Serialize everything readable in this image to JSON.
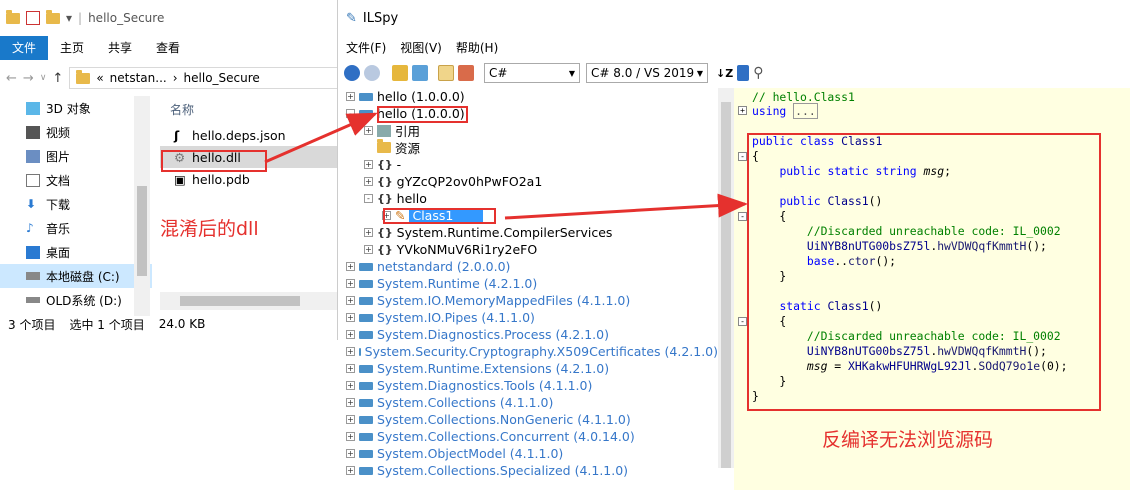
{
  "explorer": {
    "title": "hello_Secure",
    "ribbon": [
      "文件",
      "主页",
      "共享",
      "查看"
    ],
    "address": {
      "prefix": "«",
      "part1": "netstan...",
      "sep": "›",
      "part2": "hello_Secure"
    },
    "nav": [
      {
        "label": "3D 对象",
        "icon": "cube-icon"
      },
      {
        "label": "视频",
        "icon": "video-icon"
      },
      {
        "label": "图片",
        "icon": "picture-icon"
      },
      {
        "label": "文档",
        "icon": "document-icon"
      },
      {
        "label": "下载",
        "icon": "download-icon"
      },
      {
        "label": "音乐",
        "icon": "music-icon"
      },
      {
        "label": "桌面",
        "icon": "desktop-icon"
      },
      {
        "label": "本地磁盘 (C:)",
        "icon": "drive-icon"
      },
      {
        "label": "OLD系统 (D:)",
        "icon": "drive-icon"
      }
    ],
    "column_header": "名称",
    "files": [
      "hello.deps.json",
      "hello.dll",
      "hello.pdb"
    ],
    "status": {
      "count": "3 个项目",
      "selected": "选中 1 个项目",
      "size": "24.0 KB"
    }
  },
  "ilspy": {
    "title": "ILSpy",
    "menu": [
      "文件(F)",
      "视图(V)",
      "帮助(H)"
    ],
    "language": "C#",
    "version": "C# 8.0 / VS 2019",
    "tree": [
      {
        "label": "hello (1.0.0.0)",
        "exp": "+",
        "type": "asm",
        "indent": 0
      },
      {
        "label": "hello (1.0.0.0)",
        "exp": "-",
        "type": "asm",
        "indent": 0
      },
      {
        "label": "引用",
        "exp": "+",
        "type": "ref",
        "indent": 1
      },
      {
        "label": "资源",
        "exp": "",
        "type": "res",
        "indent": 1
      },
      {
        "label": "-",
        "exp": "+",
        "type": "ns",
        "indent": 1
      },
      {
        "label": "gYZcQP2ov0hPwFO2a1",
        "exp": "+",
        "type": "ns",
        "indent": 1
      },
      {
        "label": "hello",
        "exp": "-",
        "type": "ns",
        "indent": 1
      },
      {
        "label": "Class1",
        "exp": "+",
        "type": "class",
        "indent": 2
      },
      {
        "label": "System.Runtime.CompilerServices",
        "exp": "+",
        "type": "ns",
        "indent": 1
      },
      {
        "label": "YVkoNMuV6Ri1ry2eFO",
        "exp": "+",
        "type": "ns",
        "indent": 1
      },
      {
        "label": "netstandard (2.0.0.0)",
        "exp": "+",
        "type": "asm-blue",
        "indent": 0
      },
      {
        "label": "System.Runtime (4.2.1.0)",
        "exp": "+",
        "type": "asm-blue",
        "indent": 0
      },
      {
        "label": "System.IO.MemoryMappedFiles (4.1.1.0)",
        "exp": "+",
        "type": "asm-blue",
        "indent": 0
      },
      {
        "label": "System.IO.Pipes (4.1.1.0)",
        "exp": "+",
        "type": "asm-blue",
        "indent": 0
      },
      {
        "label": "System.Diagnostics.Process (4.2.1.0)",
        "exp": "+",
        "type": "asm-blue",
        "indent": 0
      },
      {
        "label": "System.Security.Cryptography.X509Certificates (4.2.1.0)",
        "exp": "+",
        "type": "asm-blue",
        "indent": 0
      },
      {
        "label": "System.Runtime.Extensions (4.2.1.0)",
        "exp": "+",
        "type": "asm-blue",
        "indent": 0
      },
      {
        "label": "System.Diagnostics.Tools (4.1.1.0)",
        "exp": "+",
        "type": "asm-blue",
        "indent": 0
      },
      {
        "label": "System.Collections (4.1.1.0)",
        "exp": "+",
        "type": "asm-blue",
        "indent": 0
      },
      {
        "label": "System.Collections.NonGeneric (4.1.1.0)",
        "exp": "+",
        "type": "asm-blue",
        "indent": 0
      },
      {
        "label": "System.Collections.Concurrent (4.0.14.0)",
        "exp": "+",
        "type": "asm-blue",
        "indent": 0
      },
      {
        "label": "System.ObjectModel (4.1.1.0)",
        "exp": "+",
        "type": "asm-blue",
        "indent": 0
      },
      {
        "label": "System.Collections.Specialized (4.1.1.0)",
        "exp": "+",
        "type": "asm-blue",
        "indent": 0
      }
    ],
    "code": {
      "header_comment": "// hello.Class1",
      "using": "using",
      "using_ellipsis": "...",
      "class_decl": [
        "public",
        "class",
        "Class1"
      ],
      "field": [
        "public",
        "static",
        "string",
        "msg"
      ],
      "ctor1": [
        "public",
        "Class1"
      ],
      "comment": "//Discarded unreachable code: IL_0002",
      "call1": [
        "UiNYB8nUTG00bsZ75l",
        "hwVDWQqfKmmtH"
      ],
      "base_call": [
        "base",
        "ctor"
      ],
      "ctor2": [
        "static",
        "Class1"
      ],
      "assign": [
        "msg",
        "XHKakwHFUHRWgL92Jl",
        "SOdQ79o1e",
        "0"
      ]
    }
  },
  "annotations": {
    "left": "混淆后的dll",
    "right": "反编译无法浏览源码"
  },
  "colors": {
    "accent_red": "#e5312e",
    "code_bg": "#ffffe1",
    "select_blue": "#3399ff"
  }
}
